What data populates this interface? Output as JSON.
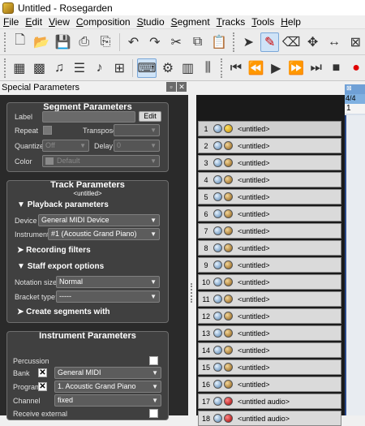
{
  "window": {
    "title": "Untitled - Rosegarden"
  },
  "menu": [
    {
      "key": "F",
      "rest": "ile"
    },
    {
      "key": "E",
      "rest": "dit"
    },
    {
      "key": "V",
      "rest": "iew"
    },
    {
      "key": "C",
      "rest": "omposition"
    },
    {
      "key": "S",
      "rest": "tudio"
    },
    {
      "key": "S",
      "rest": "egment"
    },
    {
      "key": "T",
      "rest": "racks"
    },
    {
      "key": "T",
      "rest": "ools"
    },
    {
      "key": "H",
      "rest": "elp"
    }
  ],
  "dock": {
    "title": "Special Parameters"
  },
  "segment": {
    "title": "Segment Parameters",
    "label_label": "Label",
    "edit_button": "Edit",
    "repeat_label": "Repeat",
    "transpose_label": "Transpose",
    "quantize_label": "Quantize",
    "quantize_value": "Off",
    "delay_label": "Delay",
    "delay_value": "0",
    "color_label": "Color",
    "color_value": "Default"
  },
  "track": {
    "title": "Track Parameters",
    "subtitle": "<untitled>",
    "playback_section": "Playback parameters",
    "device_label": "Device",
    "device_value": "General MIDI Device",
    "instrument_label": "Instrument",
    "instrument_value": "#1 (Acoustic Grand Piano)",
    "recording_section": "Recording filters",
    "staff_section": "Staff export options",
    "notation_label": "Notation size:",
    "notation_value": "Normal",
    "bracket_label": "Bracket type:",
    "bracket_value": "-----",
    "create_section": "Create segments with"
  },
  "instrument": {
    "title": "Instrument Parameters",
    "percussion_label": "Percussion",
    "bank_label": "Bank",
    "bank_value": "General MIDI",
    "program_label": "Program",
    "program_value": "1. Acoustic Grand Piano",
    "channel_label": "Channel",
    "channel_value": "fixed",
    "receive_label": "Receive external"
  },
  "tracks": [
    {
      "num": "1",
      "label": "<untitled>",
      "led": "yellow"
    },
    {
      "num": "2",
      "label": "<untitled>",
      "led": "amber"
    },
    {
      "num": "3",
      "label": "<untitled>",
      "led": "amber"
    },
    {
      "num": "4",
      "label": "<untitled>",
      "led": "amber"
    },
    {
      "num": "5",
      "label": "<untitled>",
      "led": "amber"
    },
    {
      "num": "6",
      "label": "<untitled>",
      "led": "amber"
    },
    {
      "num": "7",
      "label": "<untitled>",
      "led": "amber"
    },
    {
      "num": "8",
      "label": "<untitled>",
      "led": "amber"
    },
    {
      "num": "9",
      "label": "<untitled>",
      "led": "amber"
    },
    {
      "num": "10",
      "label": "<untitled>",
      "led": "amber"
    },
    {
      "num": "11",
      "label": "<untitled>",
      "led": "amber"
    },
    {
      "num": "12",
      "label": "<untitled>",
      "led": "amber"
    },
    {
      "num": "13",
      "label": "<untitled>",
      "led": "amber"
    },
    {
      "num": "14",
      "label": "<untitled>",
      "led": "amber"
    },
    {
      "num": "15",
      "label": "<untitled>",
      "led": "amber"
    },
    {
      "num": "16",
      "label": "<untitled>",
      "led": "amber"
    },
    {
      "num": "17",
      "label": "<untitled audio>",
      "led": "red"
    },
    {
      "num": "18",
      "label": "<untitled audio>",
      "led": "red"
    }
  ],
  "ruler": {
    "time_sig": "4/4",
    "bar": "1"
  }
}
